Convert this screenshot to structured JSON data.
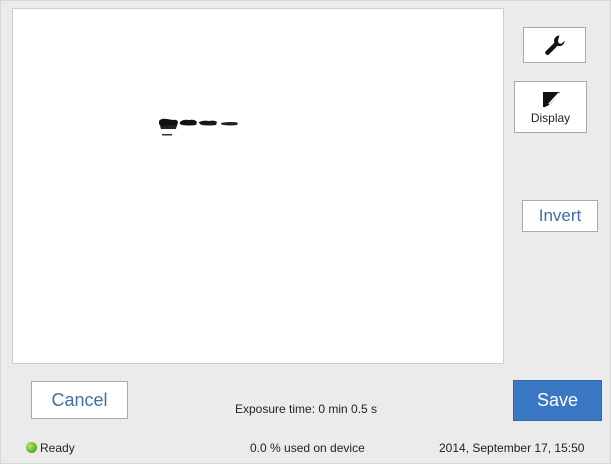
{
  "preview": {
    "description_icon": "blot-image"
  },
  "side_buttons": {
    "settings_icon": "wrench-icon",
    "display_icon": "display-icon",
    "display_label": "Display",
    "invert_label": "Invert"
  },
  "actions": {
    "cancel_label": "Cancel",
    "save_label": "Save"
  },
  "exposure_text": "Exposure time: 0 min 0.5 s",
  "status": {
    "state": "Ready",
    "indicator_color": "#4fae16",
    "storage": "0.0 % used on device",
    "datetime": "2014, September 17, 15:50"
  },
  "colors": {
    "accent": "#3b78c3",
    "link_text": "#3f6ea8"
  }
}
